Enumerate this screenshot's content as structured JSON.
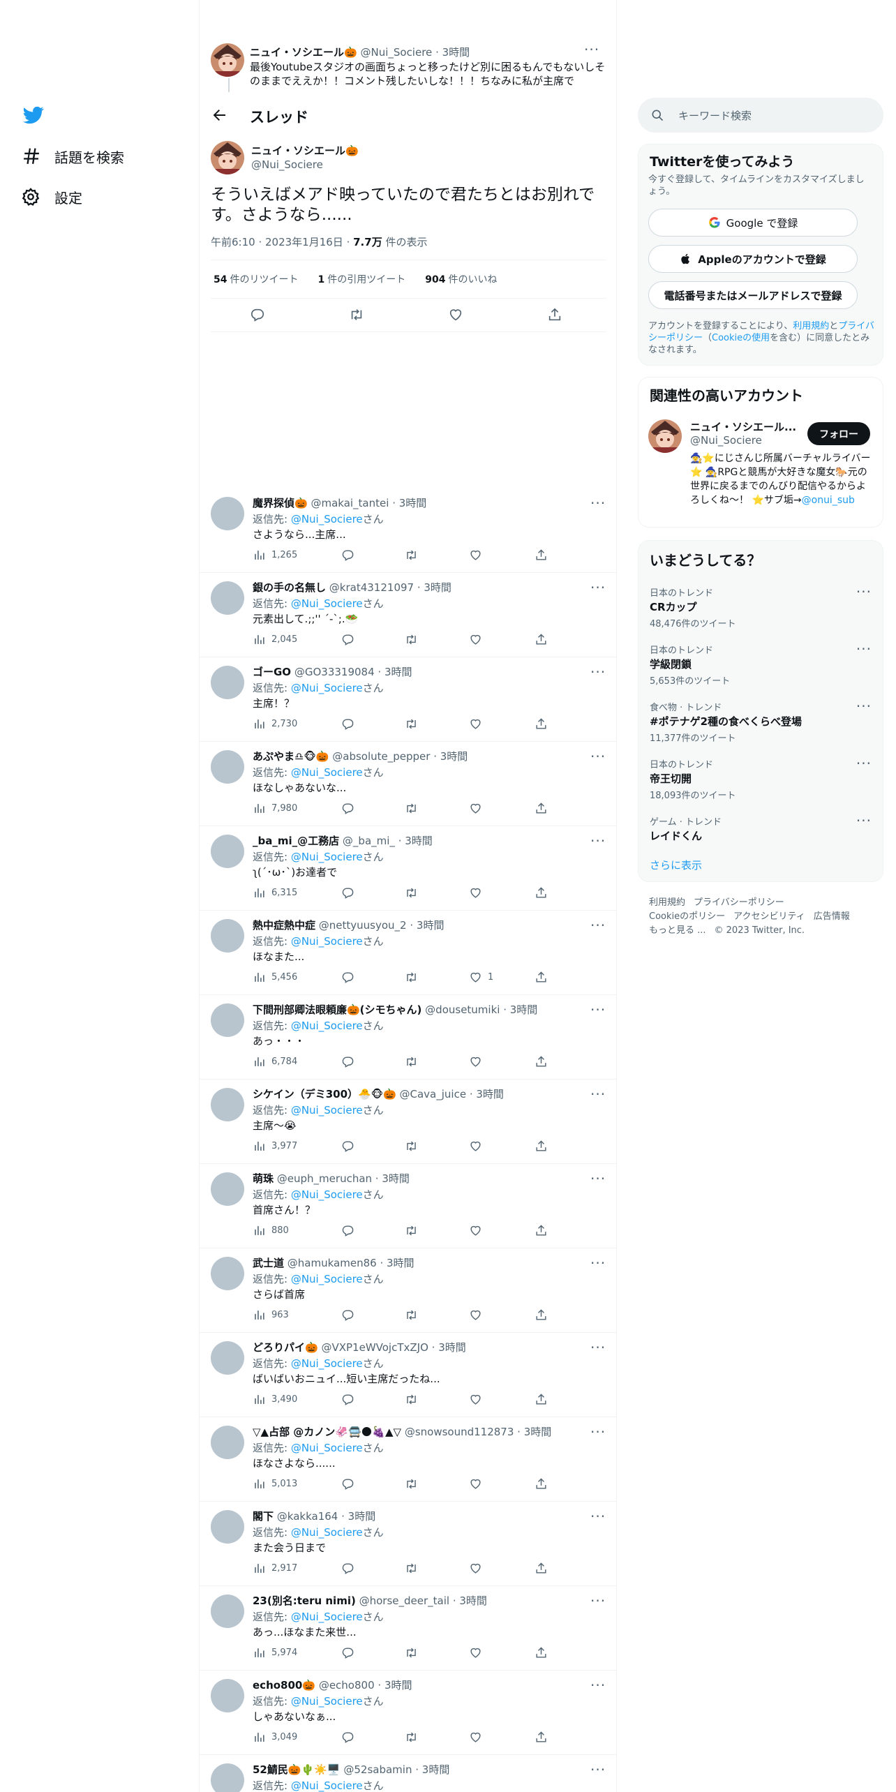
{
  "nav": {
    "explore": "話題を検索",
    "settings": "設定"
  },
  "op_tweet": {
    "name": "ニュイ・ソシエール🎃",
    "handle": "@Nui_Sociere",
    "time": "3時間",
    "text": "最後Youtubeスタジオの画面ちょっと移ったけど別に困るもんでもないしそのままでええか！！コメント残したいしな！！！ちなみに私が主席で"
  },
  "header": {
    "title": "スレッド"
  },
  "main_tweet": {
    "name": "ニュイ・ソシエール🎃",
    "handle": "@Nui_Sociere",
    "text": "そういえばメアド映っていたので君たちとはお別れです。さようなら......",
    "time": "午前6:10",
    "date": "2023年1月16日",
    "views": "7.7万",
    "views_label": "件の表示",
    "retweets": "54",
    "retweets_label": "件のリツイート",
    "quotes": "1",
    "quotes_label": "件の引用ツイート",
    "likes": "904",
    "likes_label": "件のいいね"
  },
  "reply_prefix": "返信先: ",
  "reply_suffix": "さん",
  "replies": [
    {
      "name": "魔界探偵🎃",
      "handle": "@makai_tantei",
      "time": "3時間",
      "to": "@Nui_Sociere",
      "text": "さようなら...主席...",
      "views": "1,265",
      "likes": ""
    },
    {
      "name": "銀の手の名無し",
      "handle": "@krat43121097",
      "time": "3時間",
      "to": "@Nui_Sociere",
      "text": "元素出して.;;'' ´-`;.🥗",
      "views": "2,045",
      "likes": ""
    },
    {
      "name": "ゴーGO",
      "handle": "@GO33319084",
      "time": "3時間",
      "to": "@Nui_Sociere",
      "text": "主席！？",
      "views": "2,730",
      "likes": ""
    },
    {
      "name": "あぷやま♎🐵🎃",
      "handle": "@absolute_pepper",
      "time": "3時間",
      "to": "@Nui_Sociere",
      "text": "ほなしゃあないな...",
      "views": "7,980",
      "likes": ""
    },
    {
      "name": "_ba_mi_@工務店",
      "handle": "@_ba_mi_",
      "time": "3時間",
      "to": "@Nui_Sociere",
      "text": "ʅ(´･ω･`)お達者で",
      "views": "6,315",
      "likes": ""
    },
    {
      "name": "熱中症熱中症",
      "handle": "@nettyuusyou_2",
      "time": "3時間",
      "to": "@Nui_Sociere",
      "text": "ほなまた...",
      "views": "5,456",
      "likes": "1"
    },
    {
      "name": "下間刑部卿法眼頼廉🎃(シモちゃん)",
      "handle": "@dousetumiki",
      "time": "3時間",
      "to": "@Nui_Sociere",
      "text": "あっ・・・",
      "views": "6,784",
      "likes": ""
    },
    {
      "name": "シケイン（デミ300）🐣🐵🎃",
      "handle": "@Cava_juice",
      "time": "3時間",
      "to": "@Nui_Sociere",
      "text": "主席〜😭",
      "views": "3,977",
      "likes": ""
    },
    {
      "name": "萌珠",
      "handle": "@euph_meruchan",
      "time": "3時間",
      "to": "@Nui_Sociere",
      "text": "首席さん！？",
      "views": "880",
      "likes": ""
    },
    {
      "name": "武士道",
      "handle": "@hamukamen86",
      "time": "3時間",
      "to": "@Nui_Sociere",
      "text": "さらば首席",
      "views": "963",
      "likes": ""
    },
    {
      "name": "どろりパイ🎃",
      "handle": "@VXP1eWVojcTxZJO",
      "time": "3時間",
      "to": "@Nui_Sociere",
      "text": "ばいばいおニュイ...短い主席だったね...",
      "views": "3,490",
      "likes": ""
    },
    {
      "name": "▽▲占部 @カノン🦑🚍🌑🍇▲▽",
      "handle": "@snowsound112873",
      "time": "3時間",
      "to": "@Nui_Sociere",
      "text": "ほなさよなら......",
      "views": "5,013",
      "likes": ""
    },
    {
      "name": "閣下",
      "handle": "@kakka164",
      "time": "3時間",
      "to": "@Nui_Sociere",
      "text": "また会う日まで",
      "views": "2,917",
      "likes": ""
    },
    {
      "name": "23(別名:teru nimi)",
      "handle": "@horse_deer_tail",
      "time": "3時間",
      "to": "@Nui_Sociere",
      "text": "あっ...ほなまた来世...",
      "views": "5,974",
      "likes": ""
    },
    {
      "name": "echo800🎃",
      "handle": "@echo800",
      "time": "3時間",
      "to": "@Nui_Sociere",
      "text": "しゃあないなぁ...",
      "views": "3,049",
      "likes": ""
    },
    {
      "name": "52鯖民🎃🌵☀️🖥️",
      "handle": "@52sabamin",
      "time": "3時間",
      "to": "@Nui_Sociere",
      "text": "",
      "views": "",
      "likes": ""
    }
  ],
  "sidebar": {
    "search_placeholder": "キーワード検索",
    "signup": {
      "title": "Twitterを使ってみよう",
      "subtitle": "今すぐ登録して、タイムラインをカスタマイズしましょう。",
      "google": "Google で登録",
      "apple": "Appleのアカウントで登録",
      "phone": "電話番号またはメールアドレスで登録",
      "legal_1": "アカウントを登録することにより、",
      "terms": "利用規約",
      "and": "と",
      "privacy": "プライバシーポリシー",
      "paren_open": "（",
      "cookie": "Cookieの使用",
      "legal_2": "を含む）に同意したとみなされます。"
    },
    "related": {
      "title": "関連性の高いアカウント",
      "name": "ニュイ・ソシエール...",
      "handle": "@Nui_Sociere",
      "follow": "フォロー",
      "bio": "🧙‍♀️⭐にじさんじ所属バーチャルライバー⭐ 🧙‍♀️RPGと競馬が大好きな魔女🐎元の世界に戻るまでのんびり配信やるからよろしくね〜！ ⭐サブ垢→",
      "bio_link": "@onui_sub"
    },
    "trends_title": "いまどうしてる？",
    "trends": [
      {
        "cat": "日本のトレンド",
        "name": "CRカップ",
        "count": "48,476件のツイート"
      },
      {
        "cat": "日本のトレンド",
        "name": "学級閉鎖",
        "count": "5,653件のツイート"
      },
      {
        "cat": "食べ物 · トレンド",
        "name": "#ポテナゲ2種の食べくらべ登場",
        "count": "11,377件のツイート"
      },
      {
        "cat": "日本のトレンド",
        "name": "帝王切開",
        "count": "18,093件のツイート"
      },
      {
        "cat": "ゲーム · トレンド",
        "name": "レイドくん",
        "count": ""
      }
    ],
    "show_more": "さらに表示",
    "footer": {
      "line1": [
        "利用規約",
        "プライバシーポリシー"
      ],
      "line2": [
        "Cookieのポリシー",
        "アクセシビリティ",
        "広告情報"
      ],
      "more": "もっと見る ...",
      "copyright": "© 2023 Twitter, Inc."
    }
  }
}
